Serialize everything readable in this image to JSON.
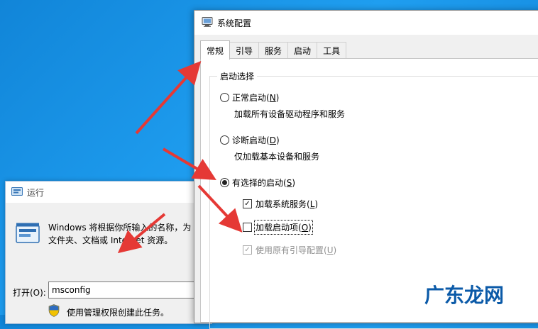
{
  "run_dialog": {
    "title": "运行",
    "description": "Windows 将根据你所输入的名称，为你打开相应的程序、文件夹、文档或 Internet 资源。",
    "description_line1": "Windows 将根据你所输入的名称，为",
    "description_line2": "文件夹、文档或 Internet 资源。",
    "open_label": "打开(O):",
    "input_value": "msconfig",
    "admin_note": "使用管理权限创建此任务。"
  },
  "msconfig": {
    "title": "系统配置",
    "tabs": [
      {
        "label": "常规",
        "active": true
      },
      {
        "label": "引导",
        "active": false
      },
      {
        "label": "服务",
        "active": false
      },
      {
        "label": "启动",
        "active": false
      },
      {
        "label": "工具",
        "active": false
      }
    ],
    "group_title": "启动选择",
    "normal": {
      "label": "正常启动(",
      "key": "N",
      "suffix": ")",
      "desc": "加载所有设备驱动程序和服务",
      "selected": false
    },
    "diagnostic": {
      "label": "诊断启动(",
      "key": "D",
      "suffix": ")",
      "desc": "仅加载基本设备和服务",
      "selected": false
    },
    "selective": {
      "label": "有选择的启动(",
      "key": "S",
      "suffix": ")",
      "selected": true
    },
    "load_system_services": {
      "label": "加载系统服务(",
      "key": "L",
      "suffix": ")",
      "checked": true
    },
    "load_startup_items": {
      "label": "加载启动项(",
      "key": "O",
      "suffix": ")",
      "checked": false
    },
    "use_original_boot": {
      "label": "使用原有引导配置(",
      "key": "U",
      "suffix": ")",
      "checked": true,
      "disabled": true
    }
  },
  "watermark": {
    "text": "广东龙网",
    "color": "#ffffff"
  },
  "colors": {
    "arrow": "#e53935",
    "desktop": "#1a90e4"
  }
}
